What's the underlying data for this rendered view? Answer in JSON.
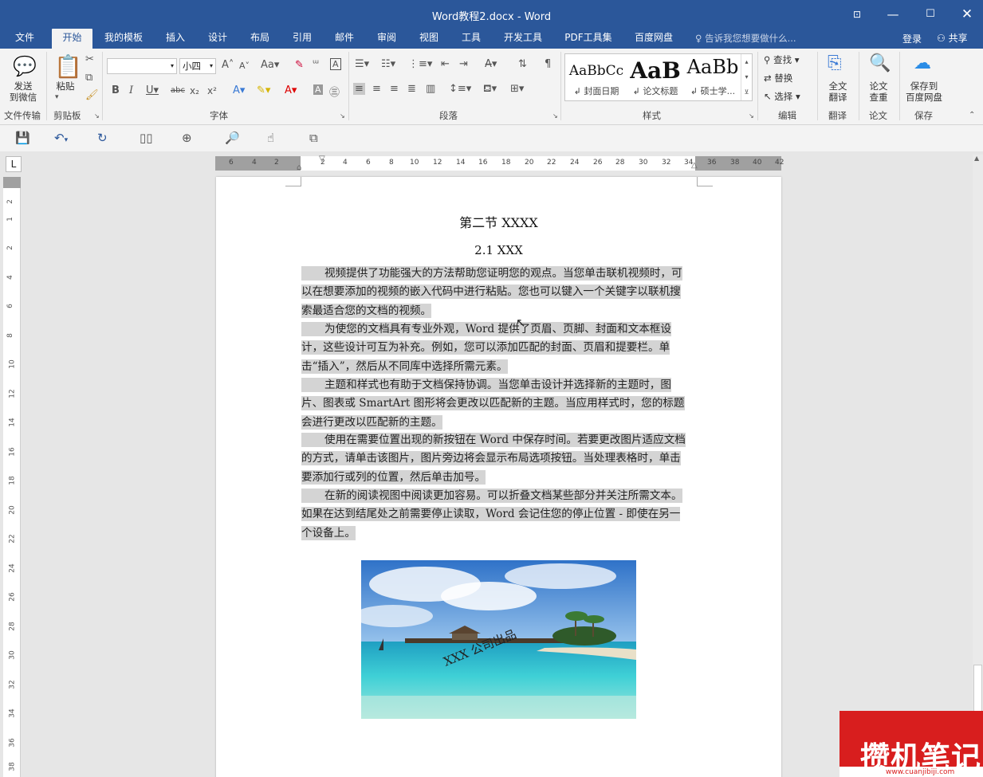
{
  "window": {
    "title": "Word教程2.docx - Word"
  },
  "menu": {
    "tabs": [
      "文件",
      "开始",
      "我的模板",
      "插入",
      "设计",
      "布局",
      "引用",
      "邮件",
      "审阅",
      "视图",
      "工具",
      "开发工具",
      "PDF工具集",
      "百度网盘"
    ],
    "active_tab": "开始",
    "tell_me": "告诉我您想要做什么...",
    "login": "登录",
    "share": "共享"
  },
  "ribbon": {
    "send": {
      "line1": "发送",
      "line2": "到微信",
      "group": "文件传输"
    },
    "clipboard": {
      "paste": "粘贴",
      "group": "剪贴板"
    },
    "font": {
      "font_name": "",
      "font_size": "小四",
      "group": "字体"
    },
    "paragraph": {
      "group": "段落"
    },
    "styles": {
      "items": [
        {
          "preview": "AaBbCc",
          "name": "封面日期"
        },
        {
          "preview": "AaB",
          "name": "论文标题"
        },
        {
          "preview": "AaBb",
          "name": "硕士学..."
        }
      ],
      "group": "样式"
    },
    "editing": {
      "find": "查找",
      "replace": "替换",
      "select": "选择",
      "group": "编辑"
    },
    "translate": {
      "line1": "全文",
      "line2": "翻译",
      "group": "翻译"
    },
    "paper": {
      "line1": "论文",
      "line2": "查重",
      "group": "论文"
    },
    "save_baidu": {
      "line1": "保存到",
      "line2": "百度网盘",
      "group": "保存"
    }
  },
  "ruler": {
    "horizontal": [
      "6",
      "4",
      "2",
      "2",
      "4",
      "6",
      "8",
      "10",
      "12",
      "14",
      "16",
      "18",
      "20",
      "22",
      "24",
      "26",
      "28",
      "30",
      "32",
      "34",
      "36",
      "38",
      "40",
      "42"
    ],
    "vertical": [
      "2",
      "1",
      "2",
      "4",
      "6",
      "8",
      "10",
      "12",
      "14",
      "16",
      "18",
      "20",
      "22",
      "24",
      "26",
      "28",
      "30",
      "32",
      "34",
      "36",
      "38"
    ]
  },
  "document": {
    "heading1": "第二节 XXXX",
    "heading2": "2.1 XXX",
    "paragraphs": [
      "视频提供了功能强大的方法帮助您证明您的观点。当您单击联机视频时，可以在想要添加的视频的嵌入代码中进行粘贴。您也可以键入一个关键字以联机搜索最适合您的文档的视频。",
      "为使您的文档具有专业外观，Word 提供了页眉、页脚、封面和文本框设计，这些设计可互为补充。例如，您可以添加匹配的封面、页眉和提要栏。单击“插入”，然后从不同库中选择所需元素。",
      "主题和样式也有助于文档保持协调。当您单击设计并选择新的主题时，图片、图表或 SmartArt 图形将会更改以匹配新的主题。当应用样式时，您的标题会进行更改以匹配新的主题。",
      "使用在需要位置出现的新按钮在 Word 中保存时间。若要更改图片适应文档的方式，请单击该图片，图片旁边将会显示布局选项按钮。当处理表格时，单击要添加行或列的位置，然后单击加号。",
      "在新的阅读视图中阅读更加容易。可以折叠文档某些部分并关注所需文本。如果在达到结尾处之前需要停止读取，Word 会记住您的停止位置 - 即使在另一个设备上。"
    ],
    "image_watermark": "XXX 公司出品"
  },
  "brand": {
    "logo": "攒机笔记",
    "url": "www.cuanjibiji.com"
  }
}
